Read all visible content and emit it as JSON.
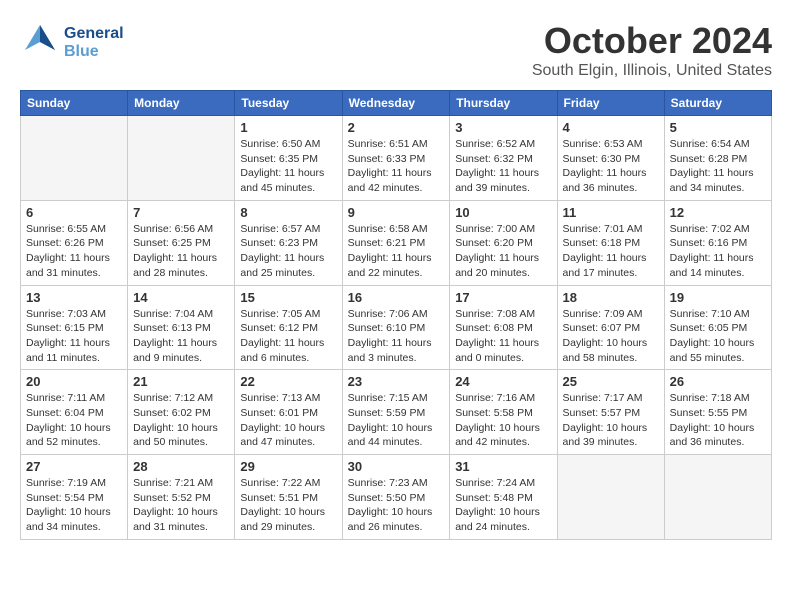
{
  "header": {
    "logo": {
      "line1": "General",
      "line2": "Blue"
    },
    "month_title": "October 2024",
    "location": "South Elgin, Illinois, United States"
  },
  "weekdays": [
    "Sunday",
    "Monday",
    "Tuesday",
    "Wednesday",
    "Thursday",
    "Friday",
    "Saturday"
  ],
  "weeks": [
    [
      {
        "day": "",
        "empty": true
      },
      {
        "day": "",
        "empty": true
      },
      {
        "day": "1",
        "sunrise": "Sunrise: 6:50 AM",
        "sunset": "Sunset: 6:35 PM",
        "daylight": "Daylight: 11 hours and 45 minutes."
      },
      {
        "day": "2",
        "sunrise": "Sunrise: 6:51 AM",
        "sunset": "Sunset: 6:33 PM",
        "daylight": "Daylight: 11 hours and 42 minutes."
      },
      {
        "day": "3",
        "sunrise": "Sunrise: 6:52 AM",
        "sunset": "Sunset: 6:32 PM",
        "daylight": "Daylight: 11 hours and 39 minutes."
      },
      {
        "day": "4",
        "sunrise": "Sunrise: 6:53 AM",
        "sunset": "Sunset: 6:30 PM",
        "daylight": "Daylight: 11 hours and 36 minutes."
      },
      {
        "day": "5",
        "sunrise": "Sunrise: 6:54 AM",
        "sunset": "Sunset: 6:28 PM",
        "daylight": "Daylight: 11 hours and 34 minutes."
      }
    ],
    [
      {
        "day": "6",
        "sunrise": "Sunrise: 6:55 AM",
        "sunset": "Sunset: 6:26 PM",
        "daylight": "Daylight: 11 hours and 31 minutes."
      },
      {
        "day": "7",
        "sunrise": "Sunrise: 6:56 AM",
        "sunset": "Sunset: 6:25 PM",
        "daylight": "Daylight: 11 hours and 28 minutes."
      },
      {
        "day": "8",
        "sunrise": "Sunrise: 6:57 AM",
        "sunset": "Sunset: 6:23 PM",
        "daylight": "Daylight: 11 hours and 25 minutes."
      },
      {
        "day": "9",
        "sunrise": "Sunrise: 6:58 AM",
        "sunset": "Sunset: 6:21 PM",
        "daylight": "Daylight: 11 hours and 22 minutes."
      },
      {
        "day": "10",
        "sunrise": "Sunrise: 7:00 AM",
        "sunset": "Sunset: 6:20 PM",
        "daylight": "Daylight: 11 hours and 20 minutes."
      },
      {
        "day": "11",
        "sunrise": "Sunrise: 7:01 AM",
        "sunset": "Sunset: 6:18 PM",
        "daylight": "Daylight: 11 hours and 17 minutes."
      },
      {
        "day": "12",
        "sunrise": "Sunrise: 7:02 AM",
        "sunset": "Sunset: 6:16 PM",
        "daylight": "Daylight: 11 hours and 14 minutes."
      }
    ],
    [
      {
        "day": "13",
        "sunrise": "Sunrise: 7:03 AM",
        "sunset": "Sunset: 6:15 PM",
        "daylight": "Daylight: 11 hours and 11 minutes."
      },
      {
        "day": "14",
        "sunrise": "Sunrise: 7:04 AM",
        "sunset": "Sunset: 6:13 PM",
        "daylight": "Daylight: 11 hours and 9 minutes."
      },
      {
        "day": "15",
        "sunrise": "Sunrise: 7:05 AM",
        "sunset": "Sunset: 6:12 PM",
        "daylight": "Daylight: 11 hours and 6 minutes."
      },
      {
        "day": "16",
        "sunrise": "Sunrise: 7:06 AM",
        "sunset": "Sunset: 6:10 PM",
        "daylight": "Daylight: 11 hours and 3 minutes."
      },
      {
        "day": "17",
        "sunrise": "Sunrise: 7:08 AM",
        "sunset": "Sunset: 6:08 PM",
        "daylight": "Daylight: 11 hours and 0 minutes."
      },
      {
        "day": "18",
        "sunrise": "Sunrise: 7:09 AM",
        "sunset": "Sunset: 6:07 PM",
        "daylight": "Daylight: 10 hours and 58 minutes."
      },
      {
        "day": "19",
        "sunrise": "Sunrise: 7:10 AM",
        "sunset": "Sunset: 6:05 PM",
        "daylight": "Daylight: 10 hours and 55 minutes."
      }
    ],
    [
      {
        "day": "20",
        "sunrise": "Sunrise: 7:11 AM",
        "sunset": "Sunset: 6:04 PM",
        "daylight": "Daylight: 10 hours and 52 minutes."
      },
      {
        "day": "21",
        "sunrise": "Sunrise: 7:12 AM",
        "sunset": "Sunset: 6:02 PM",
        "daylight": "Daylight: 10 hours and 50 minutes."
      },
      {
        "day": "22",
        "sunrise": "Sunrise: 7:13 AM",
        "sunset": "Sunset: 6:01 PM",
        "daylight": "Daylight: 10 hours and 47 minutes."
      },
      {
        "day": "23",
        "sunrise": "Sunrise: 7:15 AM",
        "sunset": "Sunset: 5:59 PM",
        "daylight": "Daylight: 10 hours and 44 minutes."
      },
      {
        "day": "24",
        "sunrise": "Sunrise: 7:16 AM",
        "sunset": "Sunset: 5:58 PM",
        "daylight": "Daylight: 10 hours and 42 minutes."
      },
      {
        "day": "25",
        "sunrise": "Sunrise: 7:17 AM",
        "sunset": "Sunset: 5:57 PM",
        "daylight": "Daylight: 10 hours and 39 minutes."
      },
      {
        "day": "26",
        "sunrise": "Sunrise: 7:18 AM",
        "sunset": "Sunset: 5:55 PM",
        "daylight": "Daylight: 10 hours and 36 minutes."
      }
    ],
    [
      {
        "day": "27",
        "sunrise": "Sunrise: 7:19 AM",
        "sunset": "Sunset: 5:54 PM",
        "daylight": "Daylight: 10 hours and 34 minutes."
      },
      {
        "day": "28",
        "sunrise": "Sunrise: 7:21 AM",
        "sunset": "Sunset: 5:52 PM",
        "daylight": "Daylight: 10 hours and 31 minutes."
      },
      {
        "day": "29",
        "sunrise": "Sunrise: 7:22 AM",
        "sunset": "Sunset: 5:51 PM",
        "daylight": "Daylight: 10 hours and 29 minutes."
      },
      {
        "day": "30",
        "sunrise": "Sunrise: 7:23 AM",
        "sunset": "Sunset: 5:50 PM",
        "daylight": "Daylight: 10 hours and 26 minutes."
      },
      {
        "day": "31",
        "sunrise": "Sunrise: 7:24 AM",
        "sunset": "Sunset: 5:48 PM",
        "daylight": "Daylight: 10 hours and 24 minutes."
      },
      {
        "day": "",
        "empty": true
      },
      {
        "day": "",
        "empty": true
      }
    ]
  ]
}
